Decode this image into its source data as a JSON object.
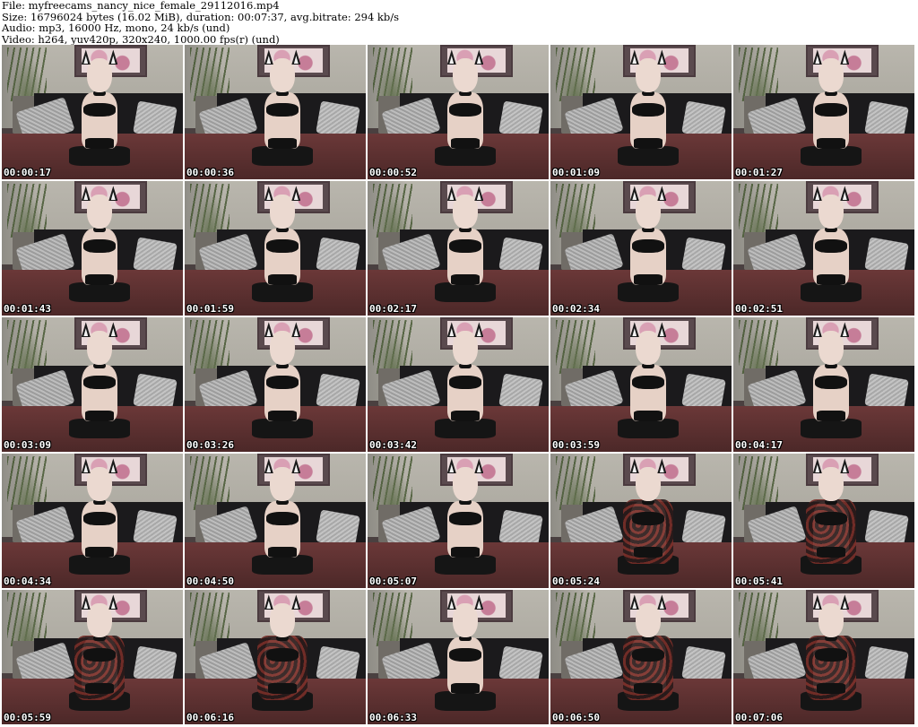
{
  "header": {
    "file": "File: myfreecams_nancy_nice_female_29112016.mp4",
    "size": "Size: 16796024 bytes (16.02 MiB), duration: 00:07:37, avg.bitrate: 294 kb/s",
    "audio": "Audio: mp3, 16000 Hz, mono, 24 kb/s (und)",
    "video": "Video: h264, yuv420p, 320x240, 1000.00 fps(r) (und)"
  },
  "thumbnails": [
    {
      "time": "00:00:17",
      "kimono": false
    },
    {
      "time": "00:00:36",
      "kimono": false
    },
    {
      "time": "00:00:52",
      "kimono": false
    },
    {
      "time": "00:01:09",
      "kimono": false
    },
    {
      "time": "00:01:27",
      "kimono": false
    },
    {
      "time": "00:01:43",
      "kimono": false
    },
    {
      "time": "00:01:59",
      "kimono": false
    },
    {
      "time": "00:02:17",
      "kimono": false
    },
    {
      "time": "00:02:34",
      "kimono": false
    },
    {
      "time": "00:02:51",
      "kimono": false
    },
    {
      "time": "00:03:09",
      "kimono": false
    },
    {
      "time": "00:03:26",
      "kimono": false
    },
    {
      "time": "00:03:42",
      "kimono": false
    },
    {
      "time": "00:03:59",
      "kimono": false
    },
    {
      "time": "00:04:17",
      "kimono": false
    },
    {
      "time": "00:04:34",
      "kimono": false
    },
    {
      "time": "00:04:50",
      "kimono": false
    },
    {
      "time": "00:05:07",
      "kimono": false
    },
    {
      "time": "00:05:24",
      "kimono": true
    },
    {
      "time": "00:05:41",
      "kimono": true
    },
    {
      "time": "00:05:59",
      "kimono": true
    },
    {
      "time": "00:06:16",
      "kimono": true
    },
    {
      "time": "00:06:33",
      "kimono": false
    },
    {
      "time": "00:06:50",
      "kimono": true
    },
    {
      "time": "00:07:06",
      "kimono": true
    }
  ]
}
